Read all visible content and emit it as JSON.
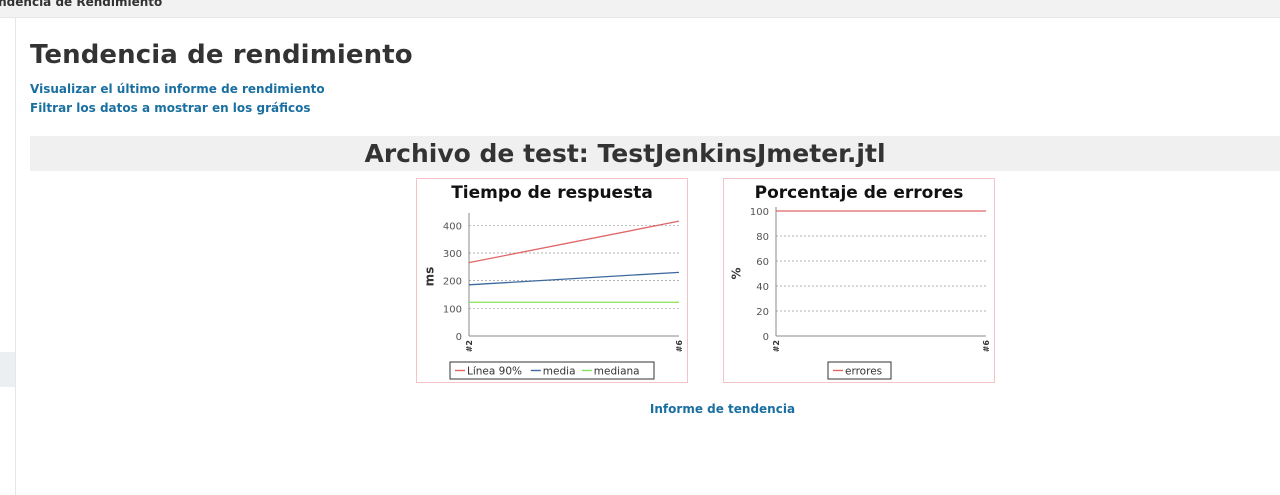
{
  "breadcrumb": {
    "label": "endencia de Rendimiento"
  },
  "page": {
    "title": "Tendencia de rendimiento",
    "links": {
      "last_report": "Visualizar el último informe de rendimiento",
      "filter_data": "Filtrar los datos a mostrar en los gráficos"
    },
    "file_heading": "Archivo de test: TestJenkinsJmeter.jtl",
    "trend_report_link": "Informe de tendencia"
  },
  "colors": {
    "line90": "#e06666",
    "media": "#3d6a9e",
    "mediana": "#86e05a",
    "errores": "#e06666",
    "link": "#1a6fa1"
  },
  "chart_data": [
    {
      "type": "line",
      "title": "Tiempo de respuesta",
      "ylabel": "ms",
      "xlabel": "",
      "x": [
        "#2",
        "#6"
      ],
      "y_ticks": [
        "0",
        "100",
        "200",
        "300",
        "400"
      ],
      "ylim": [
        0,
        430
      ],
      "grid": true,
      "legend_position": "bottom",
      "series": [
        {
          "name": "Línea 90%",
          "color_key": "line90",
          "values": [
            265,
            415
          ]
        },
        {
          "name": "media",
          "color_key": "media",
          "values": [
            185,
            230
          ]
        },
        {
          "name": "mediana",
          "color_key": "mediana",
          "values": [
            122,
            122
          ]
        }
      ]
    },
    {
      "type": "line",
      "title": "Porcentaje de errores",
      "ylabel": "%",
      "xlabel": "",
      "x": [
        "#2",
        "#6"
      ],
      "y_ticks": [
        "0",
        "20",
        "40",
        "60",
        "80",
        "100"
      ],
      "ylim": [
        0,
        100
      ],
      "grid": true,
      "legend_position": "bottom",
      "series": [
        {
          "name": "errores",
          "color_key": "errores",
          "values": [
            100,
            100
          ]
        }
      ]
    }
  ]
}
